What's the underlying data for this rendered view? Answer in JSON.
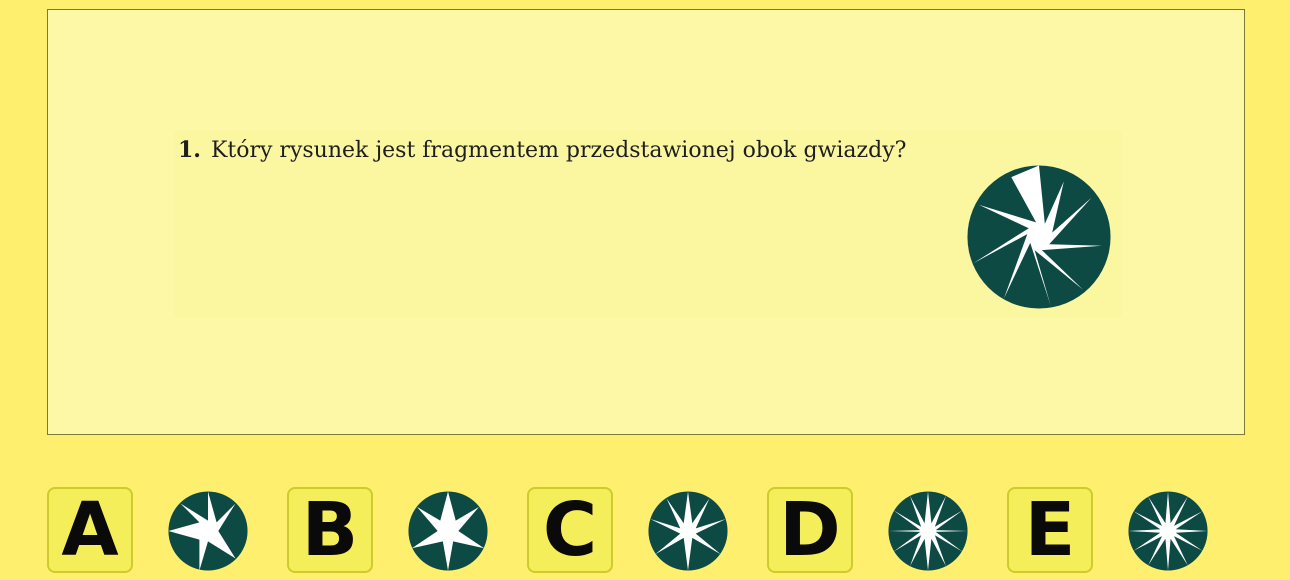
{
  "question": {
    "number": "1.",
    "text": "Który rysunek jest fragmentem przedstawionej obok gwiazdy?"
  },
  "colors": {
    "star_fill": "#0e4a44",
    "star_points": "#ffffff",
    "background": "#ffef6e",
    "panel": "#fdf8a6"
  },
  "answers": [
    {
      "letter": "A",
      "figure": "star-fragment-8-point-icon"
    },
    {
      "letter": "B",
      "figure": "star-fragment-8-point-icon"
    },
    {
      "letter": "C",
      "figure": "star-fragment-10-point-icon"
    },
    {
      "letter": "D",
      "figure": "star-fragment-12-point-icon"
    },
    {
      "letter": "E",
      "figure": "star-fragment-12-point-icon"
    }
  ]
}
